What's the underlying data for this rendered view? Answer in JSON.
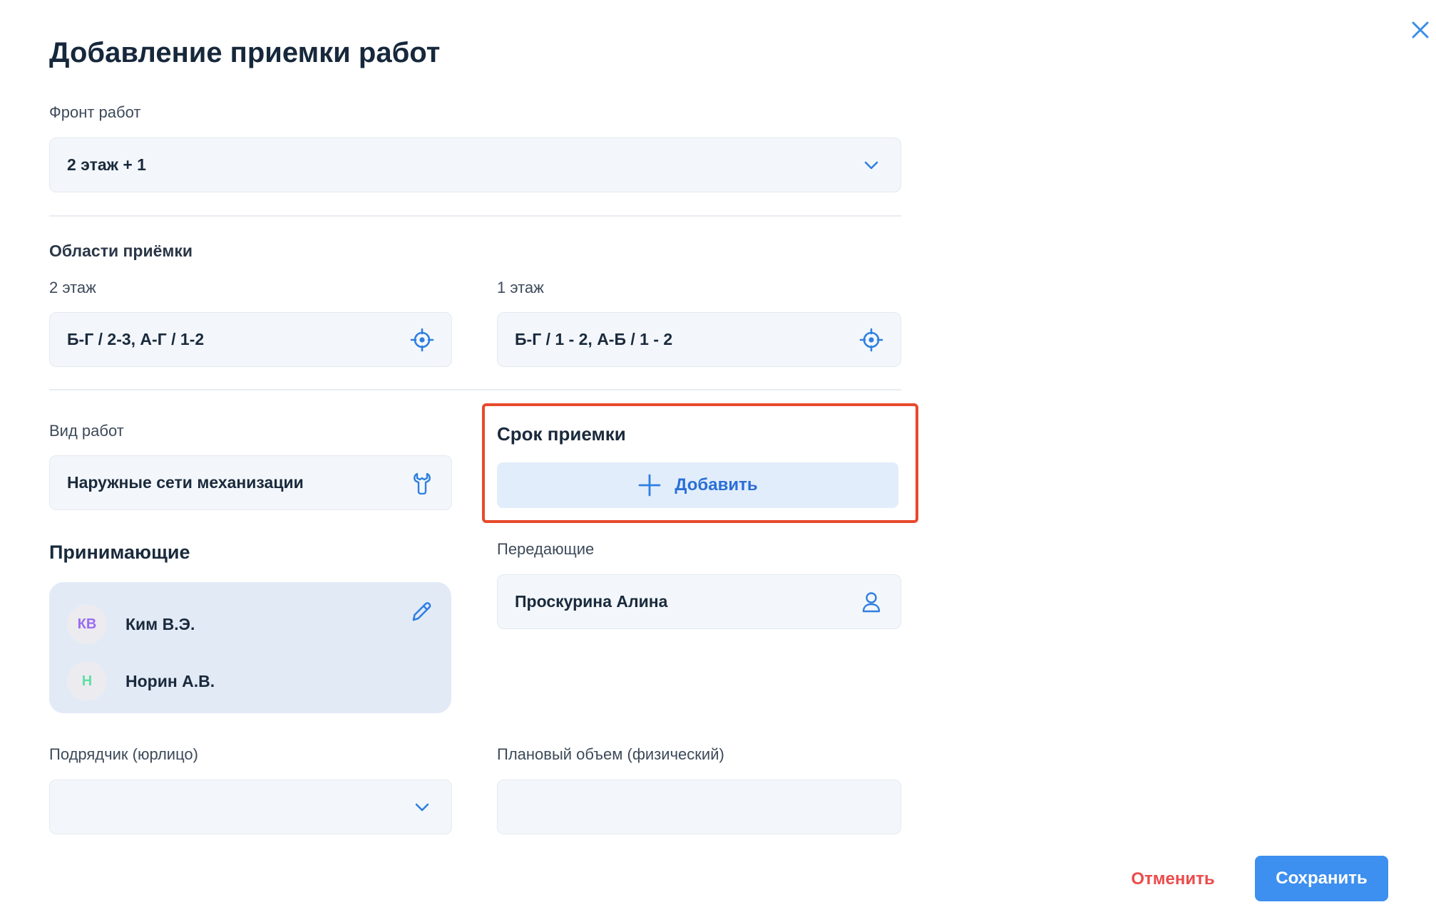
{
  "dialog": {
    "title": "Добавление приемки работ",
    "close_icon": "close-icon"
  },
  "front": {
    "label": "Фронт работ",
    "value": "2 этаж + 1",
    "icon": "chevron-down-icon"
  },
  "areas": {
    "heading": "Области приёмки",
    "items": [
      {
        "label": "2 этаж",
        "value": "Б-Г / 2-3, А-Г / 1-2",
        "icon": "target-icon"
      },
      {
        "label": "1 этаж",
        "value": "Б-Г / 1 - 2, А-Б / 1 - 2",
        "icon": "target-icon"
      }
    ]
  },
  "work_type": {
    "label": "Вид работ",
    "value": "Наружные сети механизации",
    "icon": "wrench-icon"
  },
  "deadline": {
    "heading": "Срок приемки",
    "add_label": "Добавить",
    "highlight_color": "#e8492b"
  },
  "receivers": {
    "heading": "Принимающие",
    "people": [
      {
        "initials": "КВ",
        "name": "Ким В.Э.",
        "color": "#9b6cf0"
      },
      {
        "initials": "Н",
        "name": "Норин А.В.",
        "color": "#5fe0a8"
      }
    ],
    "edit_icon": "pencil-icon"
  },
  "senders": {
    "label": "Передающие",
    "value": "Проскурина Алина",
    "icon": "user-icon"
  },
  "contractor": {
    "label": "Подрядчик (юрлицо)",
    "value": "",
    "icon": "chevron-down-icon"
  },
  "volume": {
    "label": "Плановый объем (физический)",
    "value": ""
  },
  "actions": {
    "cancel_label": "Отменить",
    "save_label": "Сохранить",
    "cancel_color": "#ec4b4b",
    "save_color": "#3d8ff0"
  }
}
